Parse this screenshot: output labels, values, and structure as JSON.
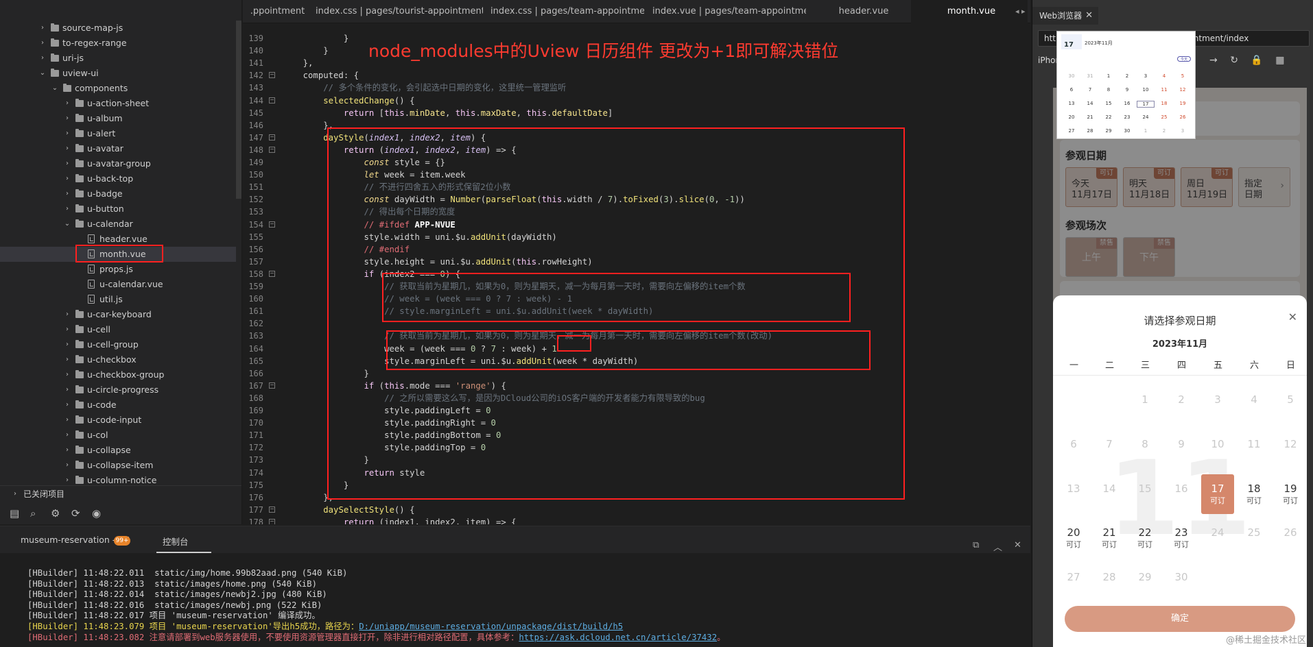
{
  "tabs": [
    {
      "label": ".ppointment",
      "active": false
    },
    {
      "label": "index.css | pages/tourist-appointment",
      "active": false
    },
    {
      "label": "index.css | pages/team-appointment",
      "active": false
    },
    {
      "label": "index.vue | pages/team-appointment",
      "active": false
    },
    {
      "label": "header.vue",
      "active": false
    },
    {
      "label": "month.vue",
      "active": true
    }
  ],
  "tab_scroll_label": "◂ ▸",
  "sidebar": {
    "tree": [
      {
        "label": "source-map-js",
        "depth": 0,
        "kind": "folder",
        "expanded": false
      },
      {
        "label": "to-regex-range",
        "depth": 0,
        "kind": "folder",
        "expanded": false
      },
      {
        "label": "uri-js",
        "depth": 0,
        "kind": "folder",
        "expanded": false
      },
      {
        "label": "uview-ui",
        "depth": 0,
        "kind": "folder",
        "expanded": true
      },
      {
        "label": "components",
        "depth": 1,
        "kind": "folder",
        "expanded": true
      },
      {
        "label": "u-action-sheet",
        "depth": 2,
        "kind": "folder",
        "expanded": false
      },
      {
        "label": "u-album",
        "depth": 2,
        "kind": "folder",
        "expanded": false
      },
      {
        "label": "u-alert",
        "depth": 2,
        "kind": "folder",
        "expanded": false
      },
      {
        "label": "u-avatar",
        "depth": 2,
        "kind": "folder",
        "expanded": false
      },
      {
        "label": "u-avatar-group",
        "depth": 2,
        "kind": "folder",
        "expanded": false
      },
      {
        "label": "u-back-top",
        "depth": 2,
        "kind": "folder",
        "expanded": false
      },
      {
        "label": "u-badge",
        "depth": 2,
        "kind": "folder",
        "expanded": false
      },
      {
        "label": "u-button",
        "depth": 2,
        "kind": "folder",
        "expanded": false
      },
      {
        "label": "u-calendar",
        "depth": 2,
        "kind": "folder",
        "expanded": true
      },
      {
        "label": "header.vue",
        "depth": 3,
        "kind": "file"
      },
      {
        "label": "month.vue",
        "depth": 3,
        "kind": "file",
        "selected": true
      },
      {
        "label": "props.js",
        "depth": 3,
        "kind": "file"
      },
      {
        "label": "u-calendar.vue",
        "depth": 3,
        "kind": "file"
      },
      {
        "label": "util.js",
        "depth": 3,
        "kind": "file"
      },
      {
        "label": "u-car-keyboard",
        "depth": 2,
        "kind": "folder",
        "expanded": false
      },
      {
        "label": "u-cell",
        "depth": 2,
        "kind": "folder",
        "expanded": false
      },
      {
        "label": "u-cell-group",
        "depth": 2,
        "kind": "folder",
        "expanded": false
      },
      {
        "label": "u-checkbox",
        "depth": 2,
        "kind": "folder",
        "expanded": false
      },
      {
        "label": "u-checkbox-group",
        "depth": 2,
        "kind": "folder",
        "expanded": false
      },
      {
        "label": "u-circle-progress",
        "depth": 2,
        "kind": "folder",
        "expanded": false
      },
      {
        "label": "u-code",
        "depth": 2,
        "kind": "folder",
        "expanded": false
      },
      {
        "label": "u-code-input",
        "depth": 2,
        "kind": "folder",
        "expanded": false
      },
      {
        "label": "u-col",
        "depth": 2,
        "kind": "folder",
        "expanded": false
      },
      {
        "label": "u-collapse",
        "depth": 2,
        "kind": "folder",
        "expanded": false
      },
      {
        "label": "u-collapse-item",
        "depth": 2,
        "kind": "folder",
        "expanded": false
      },
      {
        "label": "u-column-notice",
        "depth": 2,
        "kind": "folder",
        "expanded": false
      }
    ],
    "closed_projects": "已关闭项目",
    "toolbar_icons": [
      "file-icon",
      "search-icon",
      "settings-icon",
      "sync-icon",
      "palette-icon"
    ]
  },
  "annotation": "node_modules中的Uview 日历组件  更改为+1即可解决错位",
  "editor": {
    "lines": [
      {
        "n": "139",
        "fold": false,
        "html": "            }"
      },
      {
        "n": "140",
        "fold": false,
        "html": "        }"
      },
      {
        "n": "141",
        "fold": false,
        "html": "    },"
      },
      {
        "n": "142",
        "fold": true,
        "html": "    computed: {"
      },
      {
        "n": "143",
        "fold": false,
        "html": "        <span class=\"cm\">// 多个条件的变化，会引起选中日期的变化，这里统一管理监听</span>"
      },
      {
        "n": "144",
        "fold": true,
        "html": "        <span class=\"fn\">selectedChange</span>() {"
      },
      {
        "n": "145",
        "fold": false,
        "html": "            <span class=\"kw\">return</span> [<span class=\"th\">this</span>.<span class=\"prop\">minDate</span>, <span class=\"th\">this</span>.<span class=\"prop\">maxDate</span>, <span class=\"th\">this</span>.<span class=\"prop\">defaultDate</span>]"
      },
      {
        "n": "146",
        "fold": false,
        "html": "        },"
      },
      {
        "n": "147",
        "fold": true,
        "html": "        <span class=\"fn\">dayStyle</span>(<span class=\"par\">index1</span>, <span class=\"par\">index2</span>, <span class=\"par\">item</span>) {"
      },
      {
        "n": "148",
        "fold": true,
        "html": "            <span class=\"kw\">return</span> (<span class=\"par\">index1</span>, <span class=\"par\">index2</span>, <span class=\"par\">item</span>) =&gt; {"
      },
      {
        "n": "149",
        "fold": false,
        "html": "                <span class=\"kw2\"><i>const</i></span> style = {}"
      },
      {
        "n": "150",
        "fold": false,
        "html": "                <span class=\"kw2\"><i>let</i></span> week = item.week"
      },
      {
        "n": "151",
        "fold": false,
        "html": "                <span class=\"cm\">// 不进行四舍五入的形式保留2位小数</span>"
      },
      {
        "n": "152",
        "fold": false,
        "html": "                <span class=\"kw2\"><i>const</i></span> dayWidth = <span class=\"fn\">Number</span>(<span class=\"fn\">parseFloat</span>(<span class=\"th\">this</span>.width / <span class=\"num\">7</span>).<span class=\"fn\">toFixed</span>(<span class=\"num\">3</span>).<span class=\"fn\">slice</span>(<span class=\"num\">0</span>, <span class=\"num\">-1</span>))"
      },
      {
        "n": "153",
        "fold": false,
        "html": "                <span class=\"cm\">// 得出每个日期的宽度</span>"
      },
      {
        "n": "154",
        "fold": true,
        "html": "                <span class=\"dir\">// #ifdef</span> <b style=\"color:#fff\">APP-NVUE</b>"
      },
      {
        "n": "155",
        "fold": false,
        "html": "                style.width = uni.$u.<span class=\"fn\">addUnit</span>(dayWidth)"
      },
      {
        "n": "156",
        "fold": false,
        "html": "                <span class=\"dir\">// #endif</span>"
      },
      {
        "n": "157",
        "fold": false,
        "html": "                style.height = uni.$u.<span class=\"fn\">addUnit</span>(<span class=\"th\">this</span>.rowHeight)"
      },
      {
        "n": "158",
        "fold": true,
        "html": "                <span class=\"kw\">if</span> (index2 === <span class=\"num\">0</span>) {"
      },
      {
        "n": "159",
        "fold": false,
        "html": "                    <span class=\"cm\">// 获取当前为星期几，如果为0，则为星期天，减一为每月第一天时，需要向左偏移的item个数</span>"
      },
      {
        "n": "160",
        "fold": false,
        "html": "                    <span class=\"cm\">// week = (week === 0 ? 7 : week) - 1</span>"
      },
      {
        "n": "161",
        "fold": false,
        "html": "                    <span class=\"cm\">// style.marginLeft = uni.$u.addUnit(week * dayWidth)</span>"
      },
      {
        "n": "162",
        "fold": false,
        "html": ""
      },
      {
        "n": "163",
        "fold": false,
        "html": "                    <span class=\"cm\">// 获取当前为星期几，如果为0，则为星期天，减一为每月第一天时，需要向左偏移的item个数(改动)</span>"
      },
      {
        "n": "164",
        "fold": false,
        "html": "                    week = (week === <span class=\"num\">0</span> ? <span class=\"num\">7</span> : week) + <span class=\"num\">1</span>"
      },
      {
        "n": "165",
        "fold": false,
        "html": "                    style.marginLeft = uni.$u.<span class=\"fn\">addUnit</span>(week * dayWidth)"
      },
      {
        "n": "166",
        "fold": false,
        "html": "                }"
      },
      {
        "n": "167",
        "fold": true,
        "html": "                <span class=\"kw\">if</span> (<span class=\"th\">this</span>.mode === <span class=\"str\">'range'</span>) {"
      },
      {
        "n": "168",
        "fold": false,
        "html": "                    <span class=\"cm\">// 之所以需要这么写，是因为DCloud公司的iOS客户端的开发者能力有限导致的bug</span>"
      },
      {
        "n": "169",
        "fold": false,
        "html": "                    style.paddingLeft = <span class=\"num\">0</span>"
      },
      {
        "n": "170",
        "fold": false,
        "html": "                    style.paddingRight = <span class=\"num\">0</span>"
      },
      {
        "n": "171",
        "fold": false,
        "html": "                    style.paddingBottom = <span class=\"num\">0</span>"
      },
      {
        "n": "172",
        "fold": false,
        "html": "                    style.paddingTop = <span class=\"num\">0</span>"
      },
      {
        "n": "173",
        "fold": false,
        "html": "                }"
      },
      {
        "n": "174",
        "fold": false,
        "html": "                <span class=\"kw\">return</span> style"
      },
      {
        "n": "175",
        "fold": false,
        "html": "            }"
      },
      {
        "n": "176",
        "fold": false,
        "html": "        },"
      },
      {
        "n": "177",
        "fold": true,
        "html": "        <span class=\"fn\">daySelectStyle</span>() {"
      },
      {
        "n": "178",
        "fold": true,
        "html": "            <span class=\"kw\">return</span> (index1, index2, item) =&gt; {"
      }
    ]
  },
  "console": {
    "project_tab": "museum-reservation - H5",
    "badge": "99+",
    "console_tab": "控制台",
    "icons": [
      "expand-icon",
      "chevron-up-icon",
      "close-panel-icon"
    ],
    "lines": [
      {
        "cls": "",
        "text": "[HBuilder] 11:48:22.011  static/img/home.99b82aad.png (540 KiB)"
      },
      {
        "cls": "",
        "text": "[HBuilder] 11:48:22.013  static/images/home.png (540 KiB)"
      },
      {
        "cls": "",
        "text": "[HBuilder] 11:48:22.014  static/images/newbj2.jpg (480 KiB)"
      },
      {
        "cls": "",
        "text": "[HBuilder] 11:48:22.016  static/images/newbj.png (522 KiB)"
      },
      {
        "cls": "",
        "text": "[HBuilder] 11:48:22.017 项目 'museum-reservation' 编译成功。"
      },
      {
        "cls": "y",
        "text": "[HBuilder] 11:48:23.079 项目 'museum-reservation'导出h5成功，路径为：",
        "link": "D:/uniapp/museum-reservation/unpackage/dist/build/h5"
      },
      {
        "cls": "r",
        "text": "[HBuilder] 11:48:23.082 注意请部署到web服务器使用，不要使用资源管理器直接打开，除非进行相对路径配置，具体参考：",
        "link": "https://ask.dcloud.net.cn/article/37432",
        "tail": "。"
      }
    ]
  },
  "browser": {
    "tab_label": "Web浏览器",
    "close": "✕",
    "url": "http://localhost/#/pages/team-appointment/index",
    "device": "iPhone",
    "tools": [
      "→",
      "↻",
      "🔒",
      "▦"
    ],
    "visit_date_title": "参观日期",
    "date_chips": [
      {
        "label": "今天",
        "date": "11月17日",
        "tag": "可订"
      },
      {
        "label": "明天",
        "date": "11月18日",
        "tag": "可订"
      },
      {
        "label": "周日",
        "date": "11月19日",
        "tag": "可订"
      },
      {
        "label": "指定",
        "date": "日期",
        "tag": ""
      }
    ],
    "session_title": "参观场次",
    "sessions": [
      {
        "label": "上午",
        "tag": "禁售"
      },
      {
        "label": "下午",
        "tag": "禁售"
      }
    ],
    "popup": {
      "title": "请选择参观日期",
      "close": "✕",
      "month": "2023年11月",
      "weekdays": [
        "一",
        "二",
        "三",
        "四",
        "五",
        "六",
        "日"
      ],
      "watermark": "11",
      "rows": [
        [
          {
            "n": ""
          },
          {
            "n": ""
          },
          {
            "n": ""
          },
          {
            "n": "1",
            "dis": true
          },
          {
            "n": "2",
            "dis": true
          },
          {
            "n": "3",
            "dis": true
          },
          {
            "n": "4",
            "dis": true
          },
          {
            "n": "5",
            "dis": true
          }
        ],
        [
          {
            "n": "6",
            "dis": true
          },
          {
            "n": "7",
            "dis": true
          },
          {
            "n": "8",
            "dis": true
          },
          {
            "n": "9",
            "dis": true
          },
          {
            "n": "10",
            "dis": true
          },
          {
            "n": "11",
            "dis": true
          },
          {
            "n": "12",
            "dis": true
          }
        ],
        [
          {
            "n": "13",
            "dis": true
          },
          {
            "n": "14",
            "dis": true
          },
          {
            "n": "15",
            "dis": true
          },
          {
            "n": "16",
            "dis": true
          },
          {
            "n": "17",
            "s": "可订",
            "sel": true
          },
          {
            "n": "18",
            "s": "可订"
          },
          {
            "n": "19",
            "s": "可订"
          }
        ],
        [
          {
            "n": "20",
            "s": "可订"
          },
          {
            "n": "21",
            "s": "可订"
          },
          {
            "n": "22",
            "s": "可订"
          },
          {
            "n": "23",
            "s": "可订"
          },
          {
            "n": "24",
            "dis": true
          },
          {
            "n": "25",
            "dis": true
          },
          {
            "n": "26",
            "dis": true
          }
        ],
        [
          {
            "n": "27",
            "dis": true
          },
          {
            "n": "28",
            "dis": true
          },
          {
            "n": "29",
            "dis": true
          },
          {
            "n": "30",
            "dis": true
          }
        ]
      ],
      "confirm": "确定"
    },
    "watermark_text": "@稀土掘金技术社区"
  },
  "mini_calendar": {
    "big_day": "17",
    "title": "2023年11月",
    "button": "今天",
    "days": [
      [
        "30",
        "31",
        "1",
        "2",
        "3",
        "4",
        "5"
      ],
      [
        "6",
        "7",
        "8",
        "9",
        "10",
        "11",
        "12"
      ],
      [
        "13",
        "14",
        "15",
        "16",
        "17",
        "18",
        "19"
      ],
      [
        "20",
        "21",
        "22",
        "23",
        "24",
        "25",
        "26"
      ],
      [
        "27",
        "28",
        "29",
        "30",
        "1",
        "2",
        "3"
      ]
    ]
  }
}
